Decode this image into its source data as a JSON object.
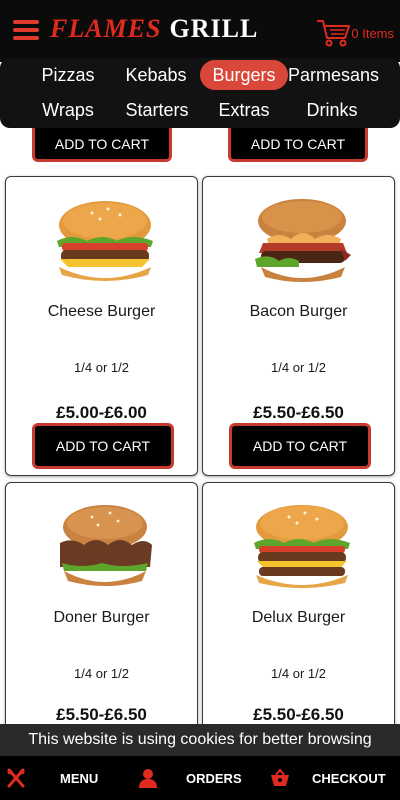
{
  "header": {
    "brand_part1": "FLAMES",
    "brand_part2": "GRILL",
    "cart_count": "0 Items"
  },
  "categories": [
    {
      "label": "Pizzas",
      "active": false
    },
    {
      "label": "Kebabs",
      "active": false
    },
    {
      "label": "Burgers",
      "active": true
    },
    {
      "label": "Parmesans",
      "active": false
    },
    {
      "label": "Wraps",
      "active": false
    },
    {
      "label": "Starters",
      "active": false
    },
    {
      "label": "Extras",
      "active": false
    },
    {
      "label": "Drinks",
      "active": false
    }
  ],
  "add_to_cart_label": "ADD TO CART",
  "products": [
    {
      "name": "Cheese Burger",
      "size": "1/4 or 1/2",
      "price": "£5.00-£6.00",
      "image": "cheese-burger-image"
    },
    {
      "name": "Bacon Burger",
      "size": "1/4 or 1/2",
      "price": "£5.50-£6.50",
      "image": "bacon-burger-image"
    },
    {
      "name": "Doner Burger",
      "size": "1/4 or 1/2",
      "price": "£5.50-£6.50",
      "image": "doner-burger-image"
    },
    {
      "name": "Delux Burger",
      "size": "1/4 or 1/2",
      "price": "£5.50-£6.50",
      "image": "delux-burger-image"
    }
  ],
  "cookie_notice": "This website is using cookies for better browsing",
  "bottom_nav": {
    "menu": "MENU",
    "orders": "ORDERS",
    "checkout": "CHECKOUT"
  },
  "colors": {
    "accent": "#d9473a",
    "brand_red": "#e02a1f",
    "header_bg": "#0b0b0b"
  }
}
